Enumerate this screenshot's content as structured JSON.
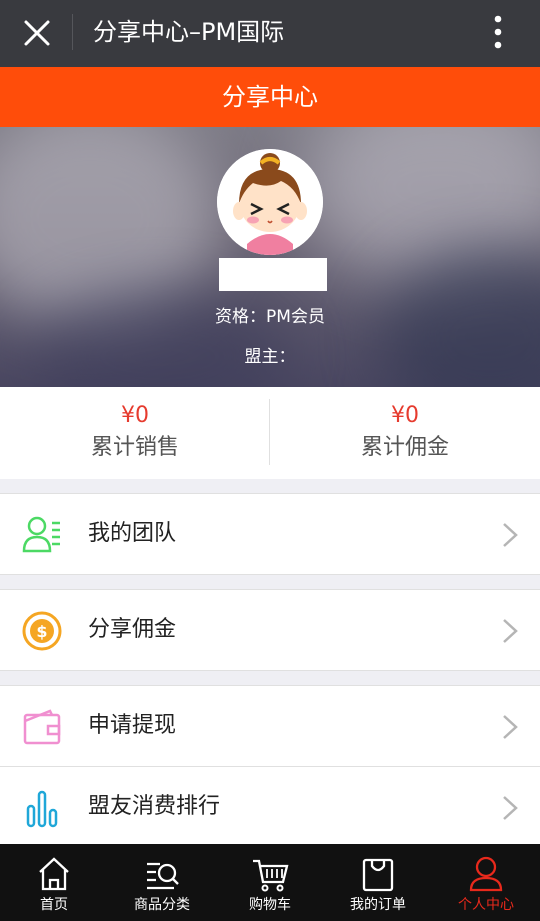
{
  "titlebar": {
    "title": "分享中心–PM国际",
    "close_icon": "close-icon",
    "more_icon": "more-vertical-icon"
  },
  "header": {
    "title": "分享中心"
  },
  "profile": {
    "avatar": "cartoon-girl-avatar",
    "qualification": "资格：PM会员",
    "alliance": "盟主："
  },
  "stats": [
    {
      "amount": "¥0",
      "label": "累计销售"
    },
    {
      "amount": "¥0",
      "label": "累计佣金"
    }
  ],
  "menu": [
    {
      "label": "我的团队",
      "icon": "team-icon",
      "color": "#4cd964"
    },
    {
      "label": "分享佣金",
      "icon": "coin-icon",
      "color": "#f5a623"
    },
    {
      "label": "申请提现",
      "icon": "wallet-icon",
      "color": "#f08fd0"
    },
    {
      "label": "盟友消费排行",
      "icon": "ranking-icon",
      "color": "#1fa7d8"
    }
  ],
  "tabs": [
    {
      "label": "首页",
      "icon": "home-icon"
    },
    {
      "label": "商品分类",
      "icon": "category-search-icon"
    },
    {
      "label": "购物车",
      "icon": "cart-icon"
    },
    {
      "label": "我的订单",
      "icon": "order-bag-icon"
    },
    {
      "label": "个人中心",
      "icon": "person-icon",
      "active": true
    }
  ],
  "colors": {
    "accent": "#ff4d0a",
    "active_tab": "#e8291c",
    "amount": "#e63b2e"
  }
}
